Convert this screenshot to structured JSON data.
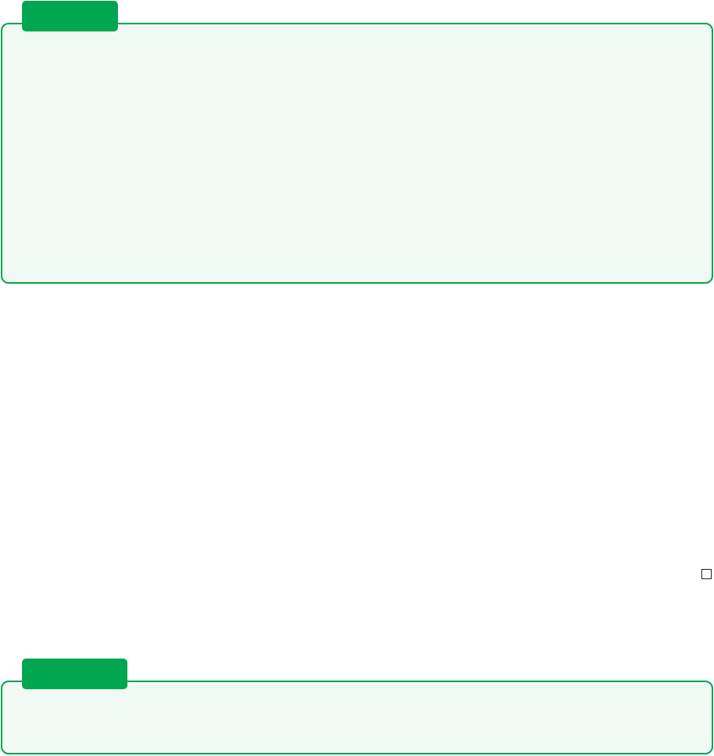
{
  "top_section": {
    "tab_label": "",
    "body_text": ""
  },
  "checkbox": {
    "label": ""
  },
  "bottom_section": {
    "tab_label": "",
    "body_text": ""
  },
  "colors": {
    "accent": "#00a650",
    "panel_background": "#f0f9f3",
    "page_background": "#ffffff"
  }
}
